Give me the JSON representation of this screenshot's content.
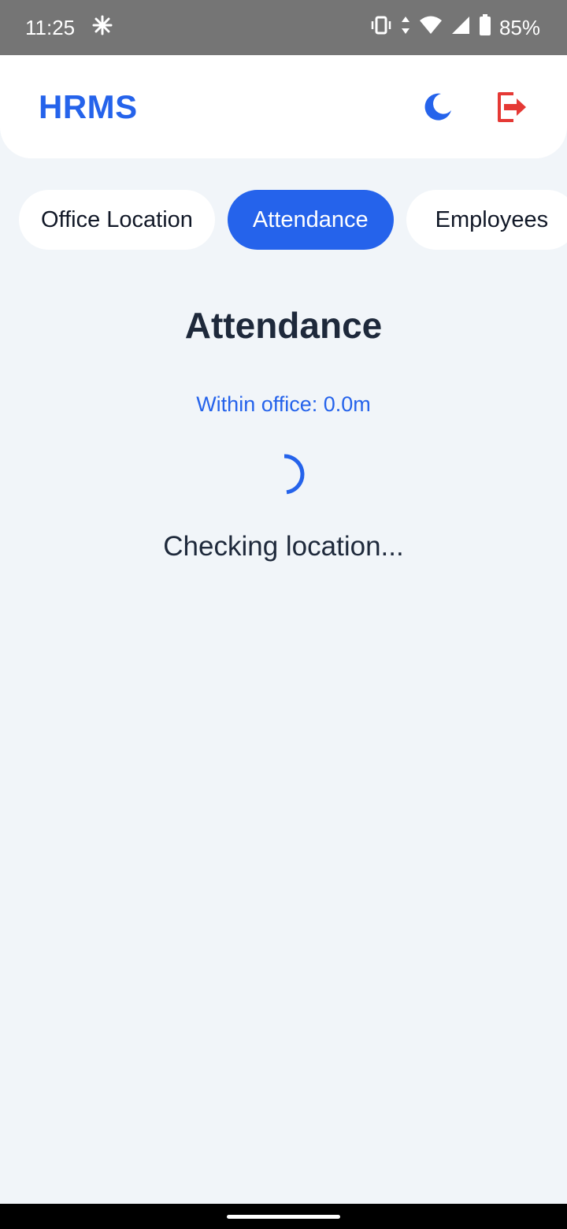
{
  "status_bar": {
    "time": "11:25",
    "battery": "85%"
  },
  "header": {
    "title": "HRMS",
    "accent_color": "#2563eb",
    "logout_color": "#e53935",
    "icons": [
      "moon-icon",
      "logout-icon"
    ]
  },
  "tabs": [
    {
      "label": "Office Location",
      "active": false
    },
    {
      "label": "Attendance",
      "active": true
    },
    {
      "label": "Employees",
      "active": false
    }
  ],
  "main": {
    "heading": "Attendance",
    "distance_text": "Within office: 0.0m",
    "status_text": "Checking location..."
  }
}
